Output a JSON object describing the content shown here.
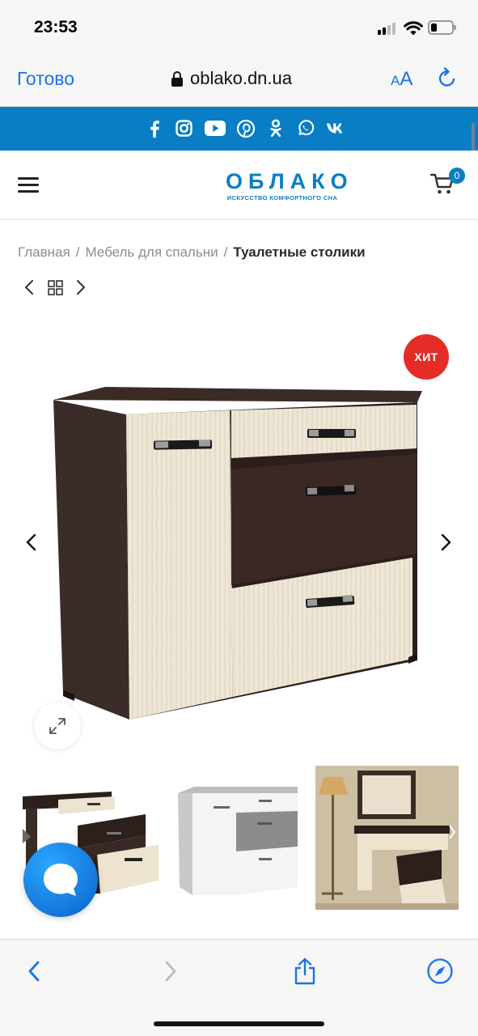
{
  "status_bar": {
    "time": "23:53",
    "battery_level": 0.3
  },
  "browser": {
    "done_label": "Готово",
    "url": "oblako.dn.ua",
    "text_size_small": "A",
    "text_size_large": "A"
  },
  "social": [
    "facebook-icon",
    "instagram-icon",
    "youtube-icon",
    "pinterest-icon",
    "odnoklassniki-icon",
    "whatsapp-icon",
    "vk-icon"
  ],
  "site": {
    "logo_main": "ОБЛАКО",
    "logo_sub": "ИСКУССТВО КОМФОРТНОГО СНА",
    "cart_count": "0"
  },
  "breadcrumb": {
    "items": [
      "Главная",
      "Мебель для спальни"
    ],
    "separator": "/",
    "current": "Туалетные столики"
  },
  "product": {
    "badge": "ХИТ"
  },
  "colors": {
    "brand": "#0a7ec5",
    "hit_badge": "#e52d27",
    "safari_blue": "#1a73e8"
  }
}
